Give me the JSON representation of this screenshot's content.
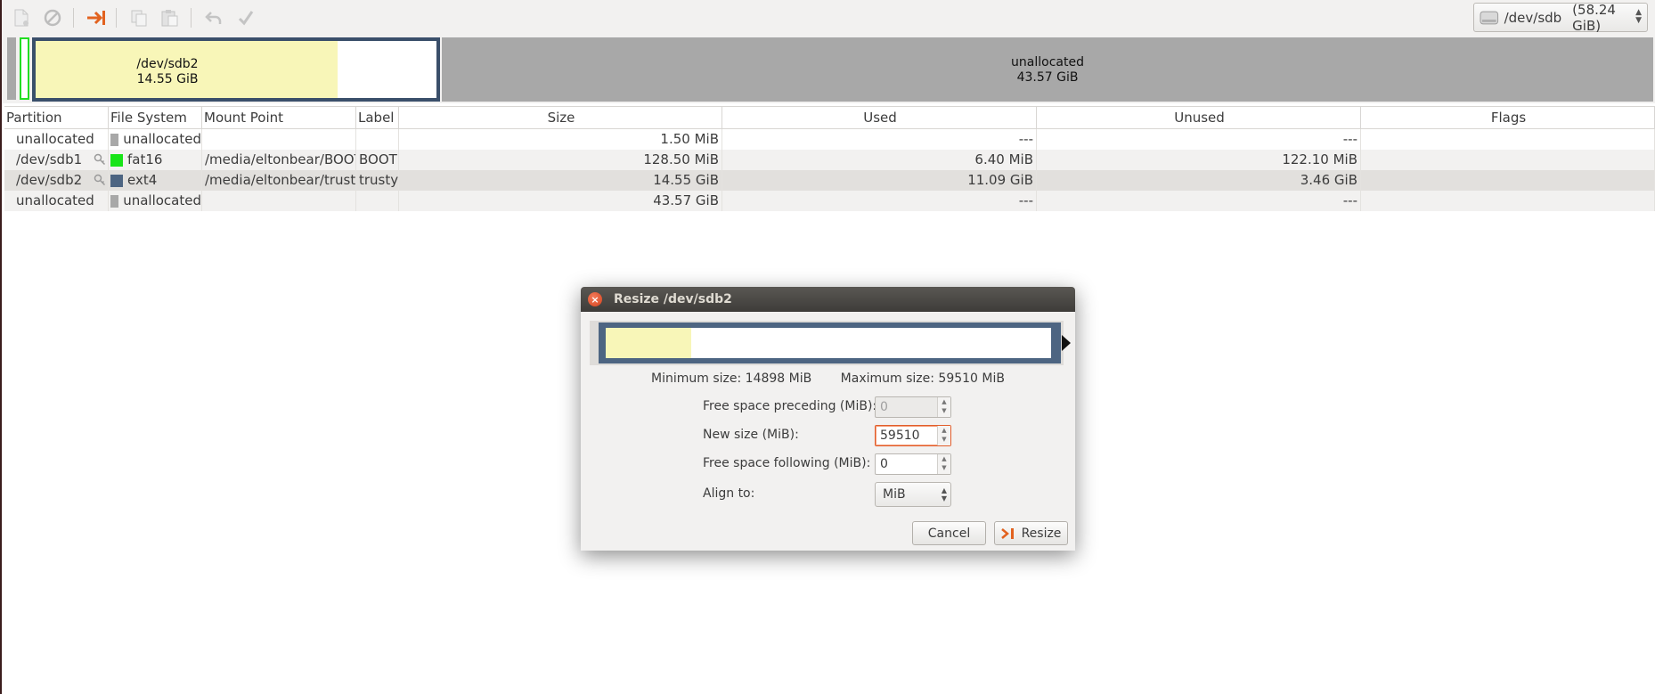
{
  "toolbar": {
    "buttons": [
      "new-partition",
      "delete-partition",
      "resize-move",
      "copy",
      "paste",
      "undo",
      "apply"
    ],
    "device": {
      "name": "/dev/sdb",
      "size": "(58.24 GiB)"
    }
  },
  "partition_map": {
    "selected": {
      "name": "/dev/sdb2",
      "size": "14.55 GiB"
    },
    "unallocated": {
      "name": "unallocated",
      "size": "43.57 GiB"
    }
  },
  "table": {
    "columns": [
      "Partition",
      "File System",
      "Mount Point",
      "Label",
      "Size",
      "Used",
      "Unused",
      "Flags"
    ],
    "rows": [
      {
        "partition": "unallocated",
        "fs": "unallocated",
        "fs_color": "#a8a8a8",
        "mount": "",
        "label": "",
        "size": "1.50 MiB",
        "used": "---",
        "unused": "---",
        "flags": ""
      },
      {
        "partition": "/dev/sdb1",
        "fs": "fat16",
        "fs_color": "#18e418",
        "mount": "/media/eltonbear/BOOT",
        "label": "BOOT",
        "size": "128.50 MiB",
        "used": "6.40 MiB",
        "unused": "122.10 MiB",
        "flags": ""
      },
      {
        "partition": "/dev/sdb2",
        "fs": "ext4",
        "fs_color": "#4d6582",
        "mount": "/media/eltonbear/trusty",
        "label": "trusty",
        "size": "14.55 GiB",
        "used": "11.09 GiB",
        "unused": "3.46 GiB",
        "flags": ""
      },
      {
        "partition": "unallocated",
        "fs": "unallocated",
        "fs_color": "#a8a8a8",
        "mount": "",
        "label": "",
        "size": "43.57 GiB",
        "used": "---",
        "unused": "---",
        "flags": ""
      }
    ]
  },
  "dialog": {
    "title": "Resize /dev/sdb2",
    "min_size": "Minimum size: 14898 MiB",
    "max_size": "Maximum size: 59510 MiB",
    "free_preceding_label": "Free space preceding (MiB):",
    "free_preceding_value": "0",
    "new_size_label": "New size (MiB):",
    "new_size_value": "59510",
    "free_following_label": "Free space following (MiB):",
    "free_following_value": "0",
    "align_label": "Align to:",
    "align_value": "MiB",
    "cancel_label": "Cancel",
    "resize_label": "Resize"
  },
  "colors": {
    "accent": "#e25d2b",
    "ext4": "#4d6582",
    "fat16": "#18e418",
    "unallocated": "#a8a8a8",
    "used": "#f8f6b8"
  }
}
